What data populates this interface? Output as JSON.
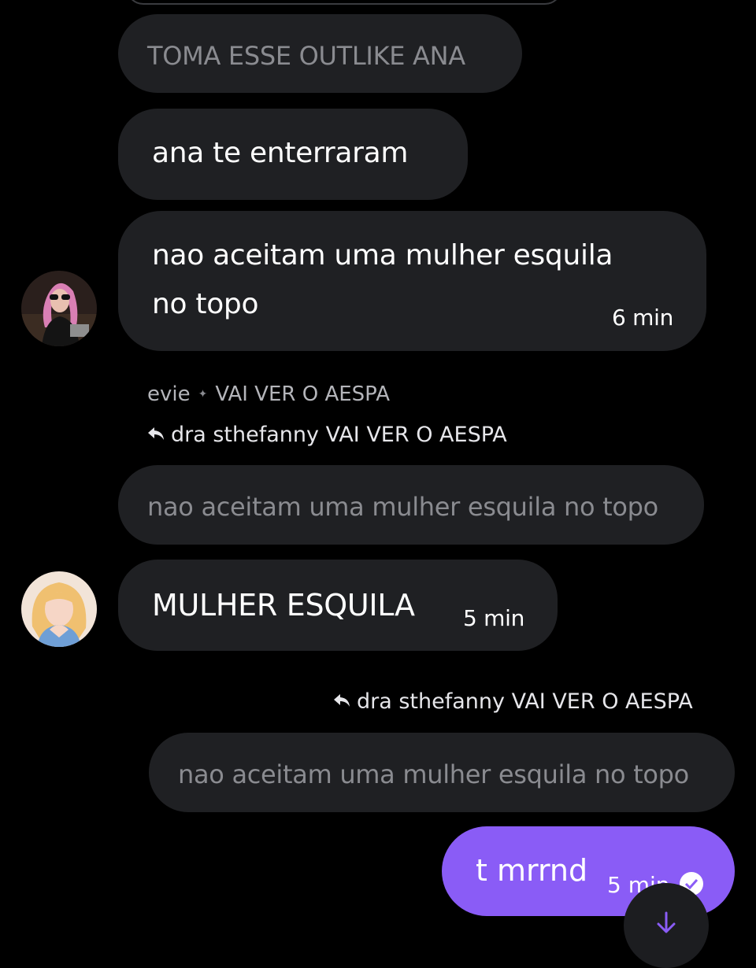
{
  "messages": {
    "quote_1": "TOMA ESSE OUTLIKE ANA",
    "msg_1": "ana te enterraram",
    "msg_2_line1": "nao aceitam uma mulher esquila",
    "msg_2_line2": "no topo",
    "msg_2_time": "6 min",
    "sender_name": "evie",
    "sender_status": "VAI VER O AESPA",
    "reply_to_1": "dra sthefanny VAI VER O AESPA",
    "quote_2": "nao aceitam uma mulher esquila no topo",
    "msg_3": "MULHER ESQUILA",
    "msg_3_time": "5 min",
    "reply_to_2": "dra sthefanny VAI VER O AESPA",
    "quote_3": "nao aceitam uma mulher esquila no topo",
    "msg_4": "t mrrnd",
    "msg_4_time": "5 min"
  },
  "colors": {
    "background": "#000000",
    "bubble": "#1f2023",
    "outgoing": "#8a5cf6"
  },
  "icons": [
    "reply-arrow-icon",
    "read-check-icon",
    "scroll-down-icon",
    "sparkle-icon"
  ]
}
